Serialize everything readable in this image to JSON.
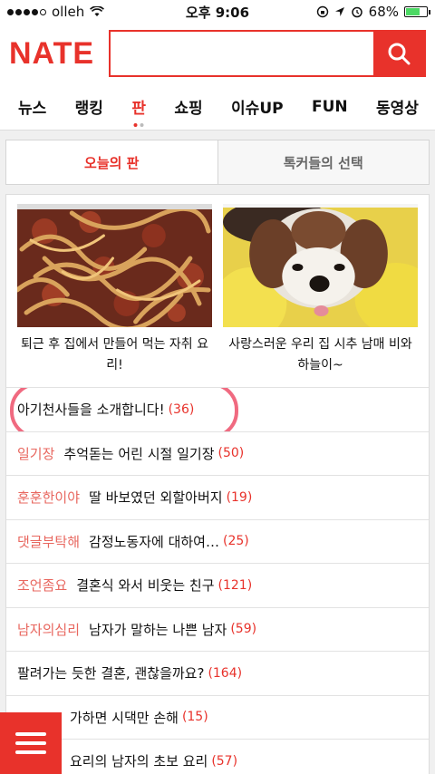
{
  "status": {
    "carrier": "olleh",
    "time": "오후 9:06",
    "battery": "68%",
    "battery_level": 0.68
  },
  "header": {
    "logo": "NATE",
    "search_placeholder": ""
  },
  "nav": [
    "뉴스",
    "랭킹",
    "판",
    "쇼핑",
    "이슈UP",
    "FUN",
    "동영상"
  ],
  "nav_active": "판",
  "tabs": {
    "today": "오늘의 판",
    "talkers": "톡커들의 선택"
  },
  "features": [
    {
      "caption": "퇴근 후 집에서 만들어 먹는 자취 요리!",
      "image": "noodle-dish"
    },
    {
      "caption": "사랑스러운 우리 집 시추 남매 비와 하늘이~",
      "image": "shih-tzu-dog"
    }
  ],
  "rows": [
    {
      "category": "",
      "title": "아기천사들을 소개합니다!",
      "count": "(36)"
    },
    {
      "category": "일기장",
      "title": "추억돋는 어린 시절 일기장",
      "count": "(50)"
    },
    {
      "category": "훈훈한이야",
      "title": "딸 바보였던 외할아버지",
      "count": "(19)"
    },
    {
      "category": "댓글부탁해",
      "title": "감정노동자에 대하여…",
      "count": "(25)"
    },
    {
      "category": "조언좀요",
      "title": "결혼식 와서 비웃는 친구",
      "count": "(121)"
    },
    {
      "category": "남자의심리",
      "title": "남자가 말하는 나쁜 남자",
      "count": "(59)"
    },
    {
      "category": "",
      "title": "팔려가는 듯한 결혼, 괜찮을까요?",
      "count": "(164)"
    },
    {
      "category": "",
      "title": "가하면 시댁만 손해",
      "count": "(15)"
    },
    {
      "category": "",
      "title": "요리의 남자의 초보 요리",
      "count": "(57)"
    }
  ],
  "colors": {
    "accent": "#e8322b",
    "category": "#e8675f",
    "highlight": "#f06a80"
  }
}
